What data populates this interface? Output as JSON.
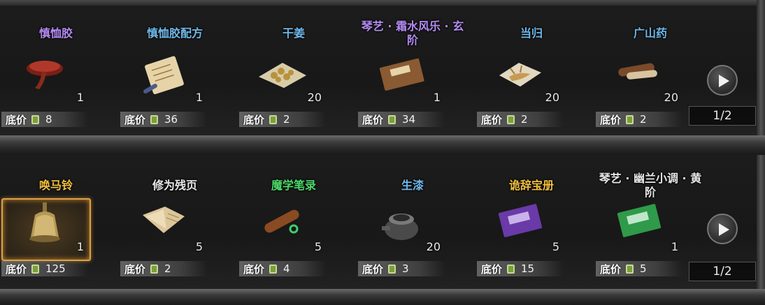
{
  "shelves": [
    {
      "items": [
        {
          "name": "慎恤胶",
          "name_color": "#b58cf5",
          "qty": "1",
          "price_label": "底价",
          "price": "8",
          "icon": "lingzhi-mushroom-icon"
        },
        {
          "name": "慎恤胶配方",
          "name_color": "#6fb8ea",
          "qty": "1",
          "price_label": "底价",
          "price": "36",
          "icon": "recipe-scroll-icon"
        },
        {
          "name": "干姜",
          "name_color": "#6fb8ea",
          "qty": "20",
          "price_label": "底价",
          "price": "2",
          "icon": "dried-ginger-icon"
        },
        {
          "name": "琴艺 · 霜水风乐 · 玄阶",
          "name_color": "#b58cf5",
          "qty": "1",
          "price_label": "底价",
          "price": "34",
          "icon": "music-book-icon"
        },
        {
          "name": "当归",
          "name_color": "#6fb8ea",
          "qty": "20",
          "price_label": "底价",
          "price": "2",
          "icon": "angelica-root-icon"
        },
        {
          "name": "广山药",
          "name_color": "#6fb8ea",
          "qty": "20",
          "price_label": "底价",
          "price": "2",
          "icon": "yam-root-icon"
        }
      ],
      "page": "1/2"
    },
    {
      "items": [
        {
          "name": "唤马铃",
          "name_color": "#f0c040",
          "qty": "1",
          "price_label": "底价",
          "price": "125",
          "icon": "bell-icon",
          "selected": true
        },
        {
          "name": "修为残页",
          "name_color": "#e8e8e8",
          "qty": "5",
          "price_label": "底价",
          "price": "2",
          "icon": "torn-page-icon"
        },
        {
          "name": "魔学笔录",
          "name_color": "#4cd96a",
          "qty": "5",
          "price_label": "底价",
          "price": "4",
          "icon": "scroll-roll-icon"
        },
        {
          "name": "生漆",
          "name_color": "#6fb8ea",
          "qty": "20",
          "price_label": "底价",
          "price": "3",
          "icon": "lacquer-pot-icon"
        },
        {
          "name": "诡辞宝册",
          "name_color": "#f0c040",
          "qty": "5",
          "price_label": "底价",
          "price": "15",
          "icon": "purple-book-icon"
        },
        {
          "name": "琴艺 · 幽兰小调 · 黄阶",
          "name_color": "#e8e8e8",
          "qty": "1",
          "price_label": "底价",
          "price": "5",
          "icon": "green-book-icon"
        }
      ],
      "page": "1/2"
    }
  ]
}
